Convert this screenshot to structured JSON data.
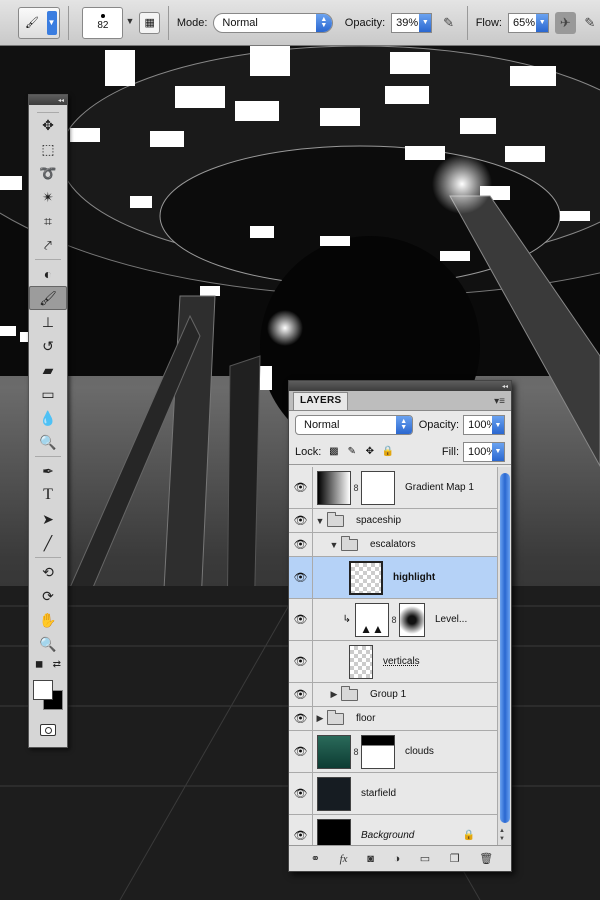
{
  "options_bar": {
    "brush_size": "82",
    "mode_label": "Mode:",
    "mode_value": "Normal",
    "opacity_label": "Opacity:",
    "opacity_value": "39%",
    "flow_label": "Flow:",
    "flow_value": "65%"
  },
  "layers_panel": {
    "tab_label": "LAYERS",
    "blend_mode": "Normal",
    "opacity_label": "Opacity:",
    "opacity_value": "100%",
    "lock_label": "Lock:",
    "fill_label": "Fill:",
    "fill_value": "100%",
    "layers": [
      {
        "name": "Gradient Map 1",
        "type": "adjustment",
        "indent": 0,
        "visible": true
      },
      {
        "name": "spaceship",
        "type": "group-open",
        "indent": 0,
        "visible": true
      },
      {
        "name": "escalators",
        "type": "group-open",
        "indent": 1,
        "visible": true
      },
      {
        "name": "highlight",
        "type": "layer",
        "indent": 2,
        "visible": true,
        "selected": true
      },
      {
        "name": "Level...",
        "type": "adjustment-clipped",
        "indent": 2,
        "visible": true
      },
      {
        "name": "verticals",
        "type": "layer",
        "indent": 2,
        "visible": true
      },
      {
        "name": "Group 1",
        "type": "group-closed",
        "indent": 1,
        "visible": true
      },
      {
        "name": "floor",
        "type": "group-closed",
        "indent": 0,
        "visible": true
      },
      {
        "name": "clouds",
        "type": "masked",
        "indent": 0,
        "visible": true
      },
      {
        "name": "starfield",
        "type": "layer",
        "indent": 0,
        "visible": true
      },
      {
        "name": "Background",
        "type": "background",
        "indent": 0,
        "visible": true,
        "locked": true
      }
    ]
  }
}
